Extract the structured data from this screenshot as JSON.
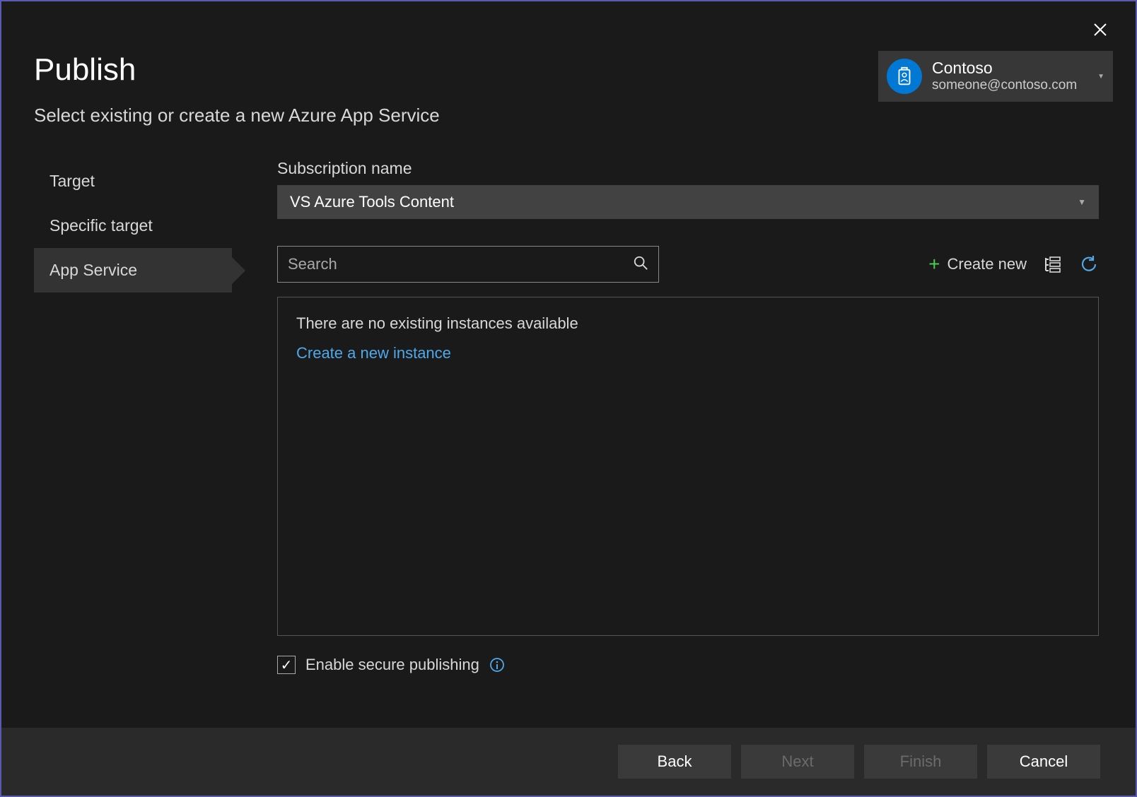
{
  "header": {
    "title": "Publish",
    "subtitle": "Select existing or create a new Azure App Service"
  },
  "account": {
    "name": "Contoso",
    "email": "someone@contoso.com"
  },
  "sidebar": {
    "items": [
      {
        "label": "Target"
      },
      {
        "label": "Specific target"
      },
      {
        "label": "App Service"
      }
    ]
  },
  "subscription": {
    "label": "Subscription name",
    "value": "VS Azure Tools Content"
  },
  "search": {
    "placeholder": "Search"
  },
  "actions": {
    "create_new": "Create new"
  },
  "panel": {
    "empty_message": "There are no existing instances available",
    "create_link": "Create a new instance"
  },
  "checkbox": {
    "label": "Enable secure publishing"
  },
  "footer": {
    "back": "Back",
    "next": "Next",
    "finish": "Finish",
    "cancel": "Cancel"
  }
}
